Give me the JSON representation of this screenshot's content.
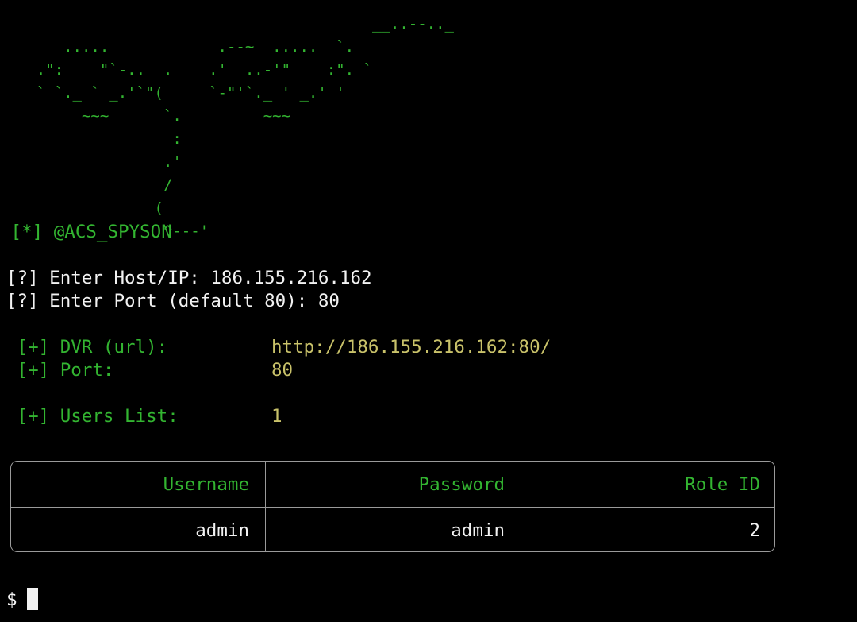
{
  "banner": {
    "art": "                                         __..--.._\n       .....            .--~  .....  `.\n    .\":    \"`-..  .    .'  ..-'\"    :\". `\n    ` `._ ` _.'`\"(     `-\"'`._ ' _.' '\n         ~~~      `.         ~~~\n                   :\n                  .'\n                  /\n                 (\n                  ^---'",
    "handle": " [*] @ACS_SPYSON"
  },
  "inputs": {
    "host_prompt": "[?] Enter Host/IP: ",
    "host_value": "186.155.216.162",
    "port_prompt": "[?] Enter Port (default 80): ",
    "port_value": "80"
  },
  "results": {
    "dvr_label": " [+] DVR (url):",
    "dvr_value": "http://186.155.216.162:80/",
    "port_label": " [+] Port:",
    "port_value": "80",
    "users_label": " [+] Users List:",
    "users_value": "1"
  },
  "table": {
    "headers": [
      "Username",
      "Password",
      "Role ID"
    ],
    "rows": [
      [
        "admin",
        "admin",
        "2"
      ]
    ]
  },
  "shell": {
    "prompt": "$"
  },
  "colors": {
    "background": "#000000",
    "green": "#33b531",
    "yellow": "#c9c26a",
    "text": "#f2f2f2",
    "border": "#9a9a9a"
  }
}
